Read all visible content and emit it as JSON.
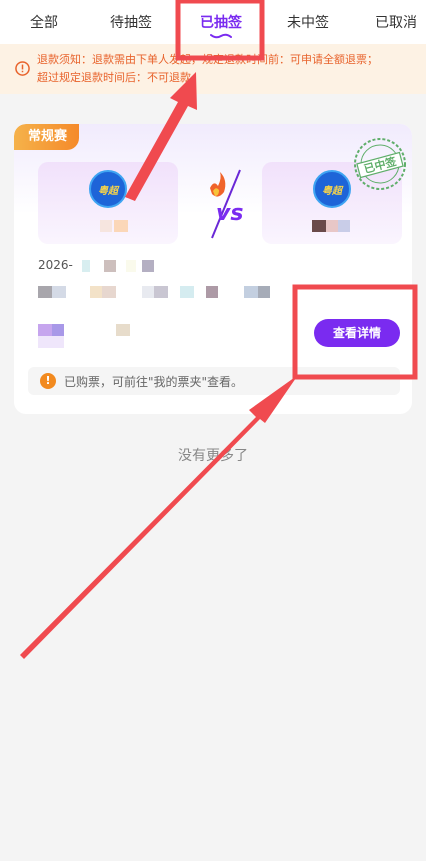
{
  "tabs": [
    {
      "label": "全部"
    },
    {
      "label": "待抽签"
    },
    {
      "label": "已抽签",
      "active": true
    },
    {
      "label": "未中签"
    },
    {
      "label": "已取消"
    }
  ],
  "notice": {
    "icon": "alert-circle-icon",
    "line1": "退款须知：退款需由下单人发起，规定退款时间前：可申请全额退票；",
    "line2": "超过规定退款时间后：不可退款。"
  },
  "card": {
    "badge": "常规赛",
    "team_logo_text": "粤超",
    "stamp_text": "已中签",
    "date_prefix": "2026-",
    "detail_button": "查看详情",
    "tip_text": "已购票，可前往\"我的票夹\"查看。"
  },
  "footer": {
    "no_more": "没有更多了"
  },
  "colors": {
    "accent": "#7a2bf0",
    "notice_bg": "#fdf2e4",
    "notice_text": "#e8632c",
    "annotation_red": "#f04a4f"
  }
}
